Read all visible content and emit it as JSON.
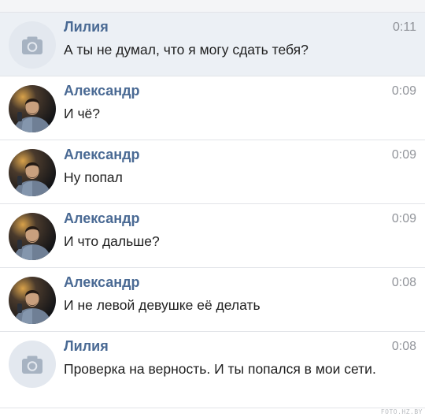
{
  "messages": [
    {
      "sender": "Лилия",
      "time": "0:11",
      "text": "А ты не думал, что я могу сдать тебя?",
      "avatar": "camera-placeholder"
    },
    {
      "sender": "Александр",
      "time": "0:09",
      "text": "И чё?",
      "avatar": "user-photo"
    },
    {
      "sender": "Александр",
      "time": "0:09",
      "text": "Ну попал",
      "avatar": "user-photo"
    },
    {
      "sender": "Александр",
      "time": "0:09",
      "text": "И что дальше?",
      "avatar": "user-photo"
    },
    {
      "sender": "Александр",
      "time": "0:08",
      "text": "И не левой девушке её делать",
      "avatar": "user-photo"
    },
    {
      "sender": "Лилия",
      "time": "0:08",
      "text": "Проверка на верность. И ты попался в мои сети.",
      "avatar": "camera-placeholder"
    }
  ],
  "watermark": "FOTO.HZ.BY",
  "colors": {
    "name": "#4a6a94",
    "highlight_bg": "#ecf0f5",
    "divider": "#e2e4e8"
  }
}
